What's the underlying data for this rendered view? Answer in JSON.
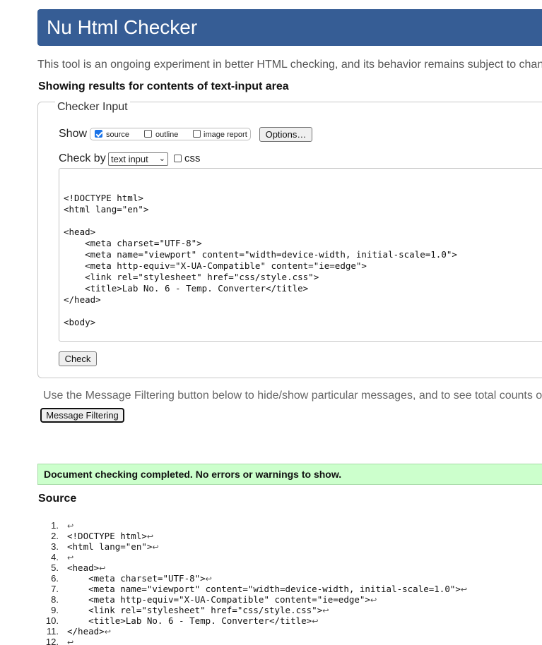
{
  "header": {
    "title": "Nu Html Checker"
  },
  "intro": "This tool is an ongoing experiment in better HTML checking, and its behavior remains subject to change",
  "results_heading": "Showing results for contents of text-input area",
  "checker_input": {
    "legend": "Checker Input",
    "show_label": "Show",
    "show_options": [
      {
        "label": "source",
        "checked": true
      },
      {
        "label": "outline",
        "checked": false
      },
      {
        "label": "image report",
        "checked": false
      }
    ],
    "options_button": "Options…",
    "check_by_label": "Check by",
    "check_by_selected": "text input",
    "css_label": "css",
    "css_checked": false,
    "textarea_value": "\n<!DOCTYPE html>\n<html lang=\"en\">\n\n<head>\n    <meta charset=\"UTF-8\">\n    <meta name=\"viewport\" content=\"width=device-width, initial-scale=1.0\">\n    <meta http-equiv=\"X-UA-Compatible\" content=\"ie=edge\">\n    <link rel=\"stylesheet\" href=\"css/style.css\">\n    <title>Lab No. 6 - Temp. Converter</title>\n</head>\n\n<body>",
    "check_button": "Check"
  },
  "filter_note": "Use the Message Filtering button below to hide/show particular messages, and to see total counts of errors and warnings.",
  "message_filtering_button": "Message Filtering",
  "status_message": "Document checking completed. No errors or warnings to show.",
  "status_color": "#ccffcc",
  "source_title": "Source",
  "return_glyph": "↩",
  "source_lines": [
    {
      "num": "1.",
      "code": ""
    },
    {
      "num": "2.",
      "code": "<!DOCTYPE html>"
    },
    {
      "num": "3.",
      "code": "<html lang=\"en\">"
    },
    {
      "num": "4.",
      "code": ""
    },
    {
      "num": "5.",
      "code": "<head>"
    },
    {
      "num": "6.",
      "code": "    <meta charset=\"UTF-8\">"
    },
    {
      "num": "7.",
      "code": "    <meta name=\"viewport\" content=\"width=device-width, initial-scale=1.0\">"
    },
    {
      "num": "8.",
      "code": "    <meta http-equiv=\"X-UA-Compatible\" content=\"ie=edge\">"
    },
    {
      "num": "9.",
      "code": "    <link rel=\"stylesheet\" href=\"css/style.css\">"
    },
    {
      "num": "10.",
      "code": "    <title>Lab No. 6 - Temp. Converter</title>"
    },
    {
      "num": "11.",
      "code": "</head>"
    },
    {
      "num": "12.",
      "code": ""
    }
  ],
  "colors": {
    "header_bg": "#365d95",
    "checkbox_checked": "#1a73e8"
  }
}
